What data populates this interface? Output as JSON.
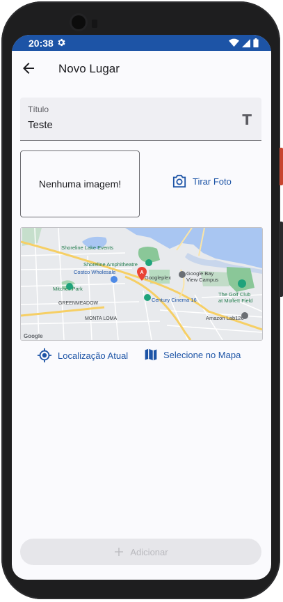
{
  "status_bar": {
    "time": "20:38",
    "icons": [
      "gear-icon",
      "wifi-icon",
      "signal-icon",
      "battery-icon"
    ],
    "color": "#1d54a6"
  },
  "app_bar": {
    "title": "Novo Lugar",
    "back_icon": "arrow-back-icon"
  },
  "form": {
    "title_field": {
      "label": "Título",
      "value": "Teste",
      "suffix_icon": "text-fields-icon"
    }
  },
  "image_preview": {
    "empty_text": "Nenhuma imagem!"
  },
  "take_photo_button": {
    "label": "Tirar Foto",
    "icon": "camera-icon"
  },
  "map_preview": {
    "labels": {
      "shoreline_lake": "Shoreline Lake Events",
      "amphitheatre": "Shoreline Amphitheatre",
      "costco": "Costco Wholesale",
      "googleplex": "Googleplex",
      "google_bay_1": "Google Bay",
      "google_bay_2": "View Campus",
      "mitchell": "Mitchell Park",
      "greenmeadow": "GREENMEADOW",
      "century": "Century Cinema 16",
      "golf_1": "The Golf Club",
      "golf_2": "at Moffett Field",
      "monta_loma": "MONTA LOMA",
      "amazon": "Amazon Lab126",
      "marker_letter": "A",
      "google_logo": "Google"
    }
  },
  "location_buttons": {
    "current_location": "Localização Atual",
    "select_on_map": "Selecione no Mapa"
  },
  "add_button": {
    "label": "Adicionar"
  },
  "colors": {
    "primary": "#1d54a6",
    "surface": "#fafafd",
    "disabled_bg": "#e6e6ea",
    "disabled_fg": "#b9b9be"
  }
}
